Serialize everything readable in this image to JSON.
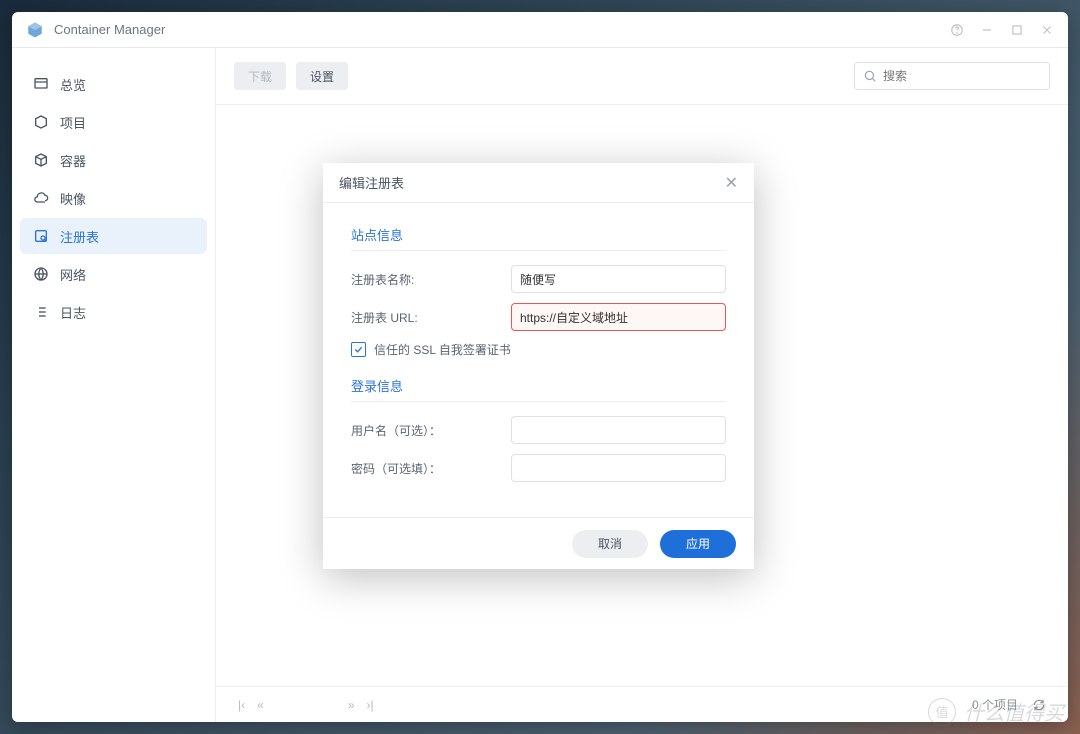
{
  "app": {
    "title": "Container Manager"
  },
  "sidebar": {
    "items": [
      {
        "label": "总览"
      },
      {
        "label": "项目"
      },
      {
        "label": "容器"
      },
      {
        "label": "映像"
      },
      {
        "label": "注册表"
      },
      {
        "label": "网络"
      },
      {
        "label": "日志"
      }
    ]
  },
  "toolbar": {
    "download": "下载",
    "settings": "设置",
    "search_placeholder": "搜索"
  },
  "footer": {
    "count": "0 个项目"
  },
  "modal": {
    "title": "编辑注册表",
    "section_site": "站点信息",
    "name_label": "注册表名称:",
    "name_value": "随便写",
    "url_label": "注册表 URL:",
    "url_value": "https://自定义域地址",
    "trust_ssl": "信任的 SSL 自我签署证书",
    "section_login": "登录信息",
    "user_label": "用户名（可选）：",
    "pass_label": "密码（可选填）：",
    "cancel": "取消",
    "apply": "应用"
  },
  "watermark": {
    "badge": "值",
    "text": "什么值得买"
  }
}
